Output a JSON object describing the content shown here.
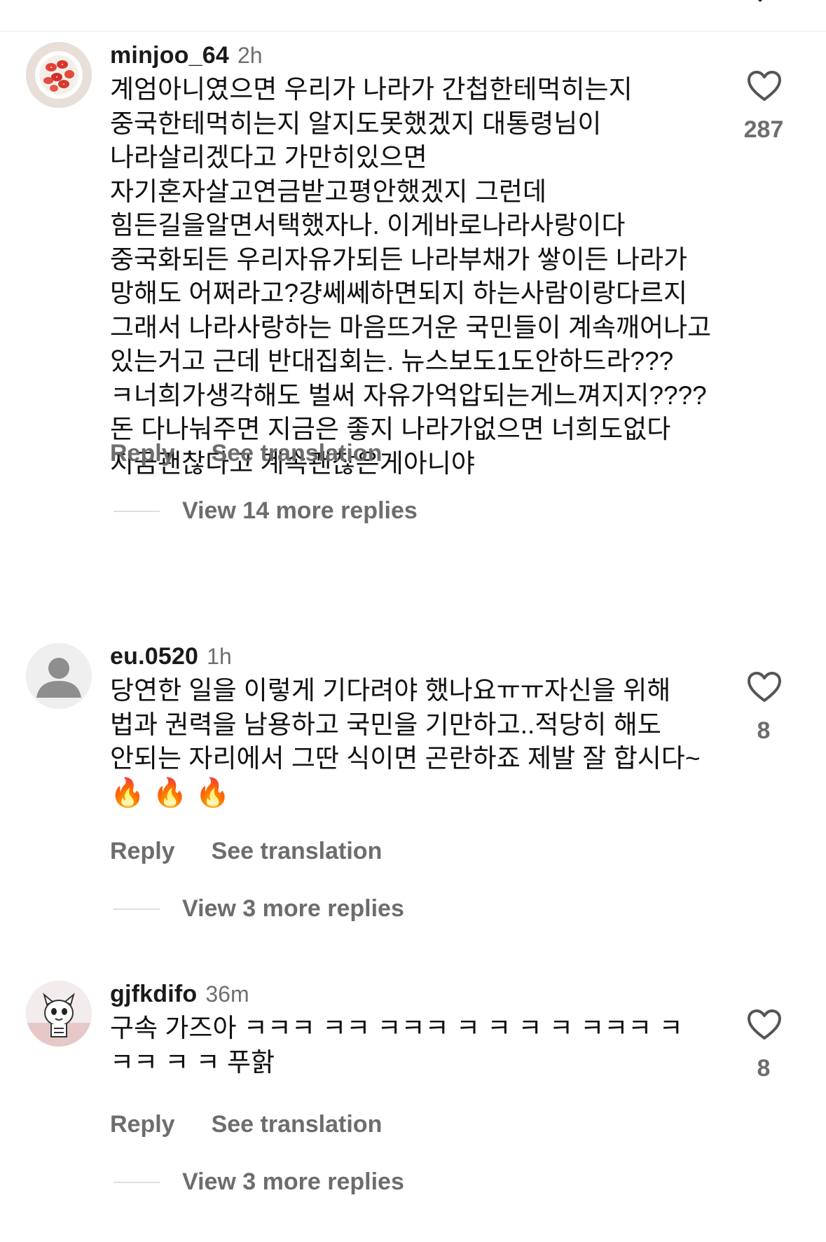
{
  "comments": [
    {
      "username": "minjoo_64",
      "time": "2h",
      "text": "계엄아니였으면 우리가 나라가 간첩한테먹히는지 중국한테먹히는지 알지도못했겠지 대통령님이 나라살리겠다고 가만히있으면 자기혼자살고연금받고평안했겠지 그런데 힘든길을알면서택했자나. 이게바로나라사랑이다 중국화되든 우리자유가되든 나라부채가 쌓이든 나라가 망해도 어쩌라고?걍쎄쎄하면되지 하는사람이랑다르지 그래서 나라사랑하는 마음뜨거운 국민들이 계속깨어나고 있는거고 근데 반대집회는. 뉴스보도1도안하드라???ㅋ너희가생각해도 벌써 자유가억압되는게느껴지지????돈 다나눠주면 지금은 좋지 나라가없으면 너희도없다 지금괜찮다고 계속괜찮은게아니야",
      "likes": "287",
      "reply_label": "Reply",
      "translate_label": "See translation",
      "view_replies": "View 14 more replies",
      "avatar_icon": "strawberries-avatar-icon"
    },
    {
      "username": "eu.0520",
      "time": "1h",
      "text": "당연한 일을 이렇게 기다려야 했나요ㅠㅠ자신을 위해 법과 권력을 남용하고 국민을 기만하고..적당히 해도 안되는 자리에서 그딴 식이면 곤란하죠 제발 잘 합시다~",
      "emoji": "🔥 🔥 🔥",
      "likes": "8",
      "reply_label": "Reply",
      "translate_label": "See translation",
      "view_replies": "View 3 more replies",
      "avatar_icon": "default-person-avatar-icon"
    },
    {
      "username": "gjfkdifo",
      "time": "36m",
      "text": "구속 가즈아 ㅋㅋㅋ ㅋㅋ ㅋㅋㅋ ㅋ ㅋ ㅋ ㅋ ㅋㅋㅋ ㅋ ㅋㅋ ㅋ ㅋ 푸핡",
      "likes": "8",
      "reply_label": "Reply",
      "translate_label": "See translation",
      "view_replies": "View 3 more replies",
      "avatar_icon": "cartoon-character-avatar-icon"
    }
  ],
  "colors": {
    "text": "#111111",
    "muted": "#6d6d6d",
    "divider": "#dedede"
  }
}
